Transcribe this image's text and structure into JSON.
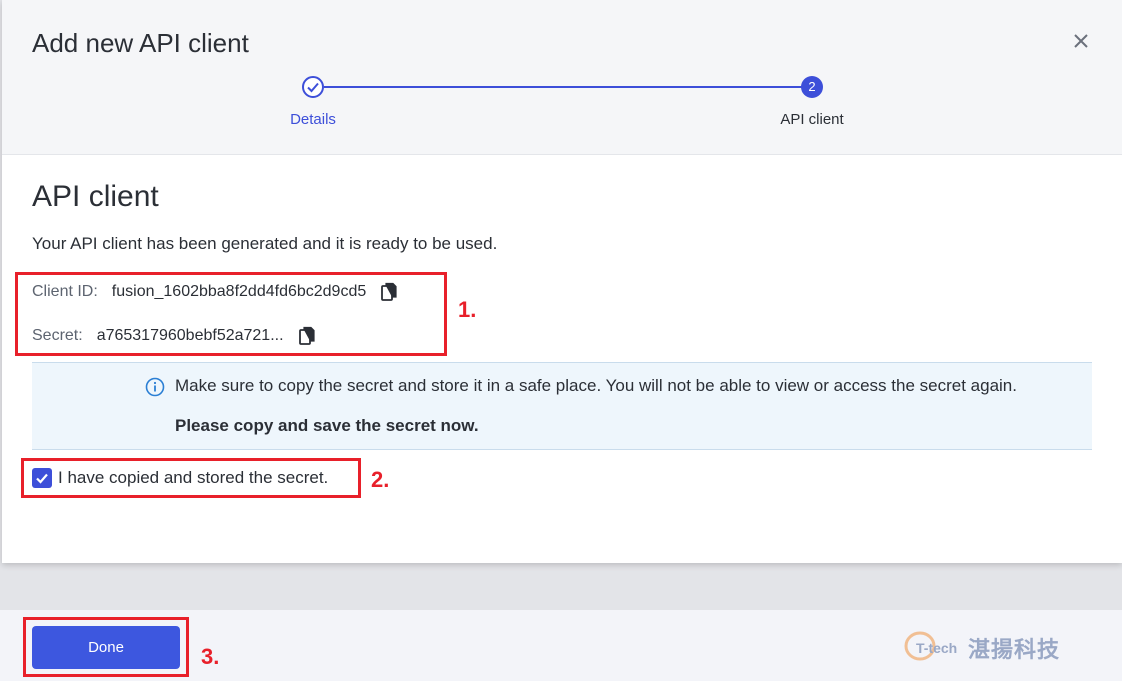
{
  "modal": {
    "title": "Add new API client",
    "close_icon": "close-icon"
  },
  "stepper": {
    "steps": [
      {
        "label": "Details",
        "state": "completed",
        "icon": "check-icon"
      },
      {
        "label": "API client",
        "number": "2",
        "state": "active"
      }
    ],
    "accent_color": "#3d4fd9"
  },
  "content": {
    "title": "API client",
    "description": "Your API client has been generated and it is ready to be used.",
    "client_id_label": "Client ID:",
    "client_id_value": "fusion_1602bba8f2dd4fd6bc2d9cd5",
    "secret_label": "Secret:",
    "secret_value": "a765317960bebf52a721...",
    "copy_icon": "copy-icon"
  },
  "info": {
    "icon": "info-icon",
    "message": "Make sure to copy the secret and store it in a safe place. You will not be able to view or access the secret again.",
    "emphasis": "Please copy and save the secret now."
  },
  "confirmation": {
    "label": "I have copied and stored the secret.",
    "checked": true
  },
  "footer": {
    "done_label": "Done",
    "button_color": "#3d57df"
  },
  "annotations": {
    "color": "#e8202a",
    "labels": [
      "1.",
      "2.",
      "3."
    ]
  },
  "watermark": {
    "brand": "T-tech",
    "text": "湛揚科技"
  }
}
